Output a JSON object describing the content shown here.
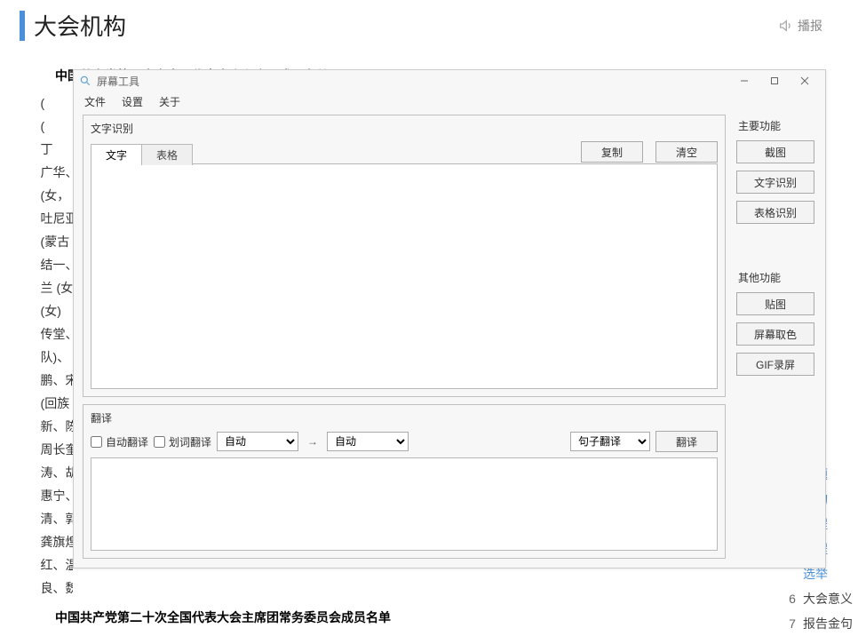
{
  "background": {
    "title": "大会机构",
    "audio_label": "播报",
    "section1": "中国共产党第二十次全国代表大会主席团成员名单",
    "section2": "中国共产党第二十次全国代表大会主席团常务委员会成员名单",
    "text_rows": [
      "(",
      "(",
      "丁",
      "广华、",
      "(女，",
      "吐尼亚",
      "(蒙古",
      "结一、",
      "兰 (女",
      "(女)",
      "传堂、",
      "队)、",
      "鹏、宋",
      "(回族",
      "新、陈",
      "周长奎",
      "涛、胡",
      "惠宁、",
      "清、郭",
      "龚旗煌",
      "红、温",
      "良、魏"
    ],
    "nav": [
      {
        "num": "",
        "label": "主题",
        "cut": true
      },
      {
        "num": "",
        "label": "机构",
        "cut": true
      },
      {
        "num": "",
        "label": "进程",
        "cut": true
      },
      {
        "num": "",
        "label": "议程",
        "cut": true
      },
      {
        "num": "",
        "label": "选举",
        "cut": true
      },
      {
        "num": "6",
        "label": "大会意义"
      },
      {
        "num": "7",
        "label": "报告金句"
      }
    ]
  },
  "dialog": {
    "app_title": "屏幕工具",
    "menu": {
      "file": "文件",
      "settings": "设置",
      "about": "关于"
    },
    "ocr": {
      "panel_title": "文字识别",
      "tab_text": "文字",
      "tab_table": "表格",
      "copy": "复制",
      "clear": "清空",
      "content": ""
    },
    "translate": {
      "panel_title": "翻译",
      "auto_translate": "自动翻译",
      "select_translate": "划词翻译",
      "lang_from": "自动",
      "lang_to": "自动",
      "mode": "句子翻译",
      "go": "翻译",
      "content": ""
    },
    "right": {
      "main_title": "主要功能",
      "screenshot": "截图",
      "ocr": "文字识别",
      "table_ocr": "表格识别",
      "other_title": "其他功能",
      "pin": "贴图",
      "color_pick": "屏幕取色",
      "gif": "GIF录屏"
    }
  }
}
